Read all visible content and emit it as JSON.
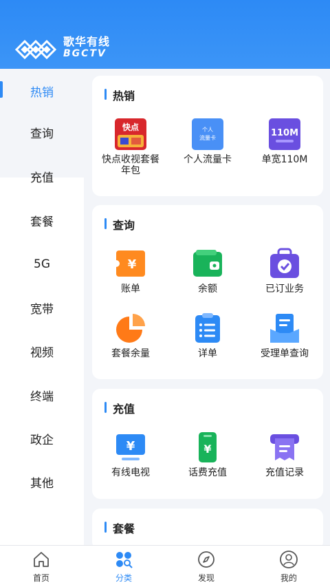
{
  "header": {
    "brand_cn": "歌华有线",
    "brand_en": "BGCTV"
  },
  "sidebar": {
    "items": [
      {
        "label": "热销",
        "active": true
      },
      {
        "label": "查询"
      },
      {
        "label": "充值"
      },
      {
        "label": "套餐"
      },
      {
        "label": "5G"
      },
      {
        "label": "宽带"
      },
      {
        "label": "视频"
      },
      {
        "label": "终端"
      },
      {
        "label": "政企"
      },
      {
        "label": "其他"
      }
    ]
  },
  "sections": {
    "hot": {
      "title": "热销",
      "tiles": [
        {
          "label": "快点收视套餐年包",
          "icon": "kuaidian-package-icon",
          "icon_text": "快点"
        },
        {
          "label": "个人流量卡",
          "icon": "personal-data-card-icon",
          "icon_text": "个人流量卡"
        },
        {
          "label": "单宽110M",
          "icon": "broadband-110m-icon",
          "icon_text": "110M"
        }
      ]
    },
    "query": {
      "title": "查询",
      "tiles": [
        {
          "label": "账单",
          "icon": "bill-icon"
        },
        {
          "label": "余额",
          "icon": "wallet-icon"
        },
        {
          "label": "已订业务",
          "icon": "subscribed-bag-icon"
        },
        {
          "label": "套餐余量",
          "icon": "pie-chart-icon"
        },
        {
          "label": "详单",
          "icon": "list-clipboard-icon"
        },
        {
          "label": "受理单查询",
          "icon": "document-tray-icon"
        }
      ]
    },
    "recharge": {
      "title": "充值",
      "tiles": [
        {
          "label": "有线电视",
          "icon": "tv-yuan-icon"
        },
        {
          "label": "话费充值",
          "icon": "phone-yuan-icon"
        },
        {
          "label": "充值记录",
          "icon": "receipt-printer-icon"
        }
      ]
    },
    "package": {
      "title": "套餐"
    }
  },
  "bottom_nav": {
    "items": [
      {
        "label": "首页",
        "icon": "home-icon"
      },
      {
        "label": "分类",
        "icon": "category-icon",
        "active": true
      },
      {
        "label": "发现",
        "icon": "compass-icon"
      },
      {
        "label": "我的",
        "icon": "user-icon"
      }
    ]
  },
  "colors": {
    "accent": "#2d8af5",
    "header": "#2d8af5",
    "page_bg": "#f3f5f9"
  }
}
